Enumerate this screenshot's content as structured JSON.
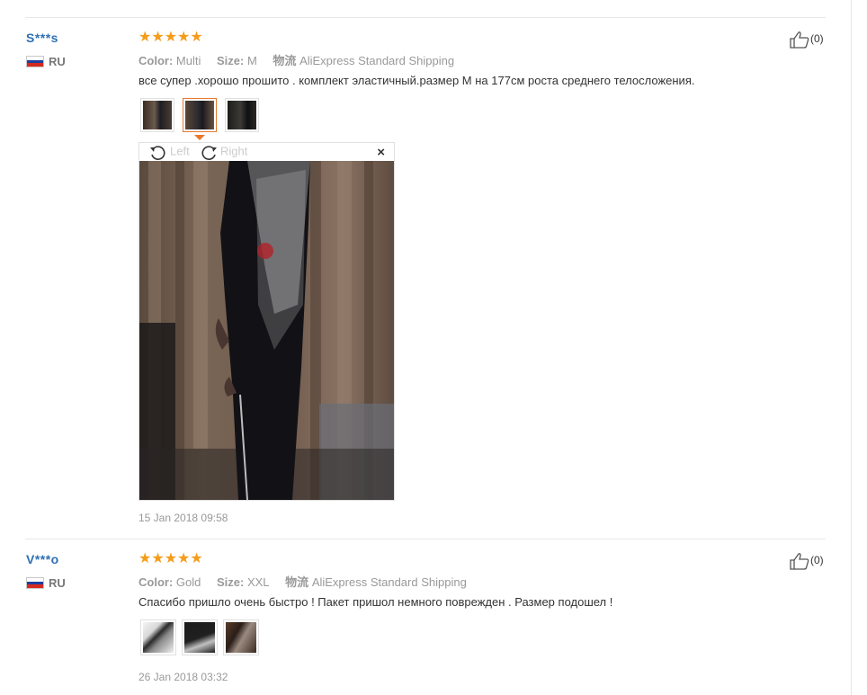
{
  "reviews": [
    {
      "user": "S***s",
      "country": "RU",
      "stars": "★★★★★",
      "color_label": "Color:",
      "color_value": "Multi",
      "size_label": "Size:",
      "size_value": "M",
      "shipping_label": "物流",
      "shipping_value": "AliExpress Standard Shipping",
      "text": "все супер .хорошо прошито . комплект эластичный.размер М на 177см роста среднего телосложения.",
      "likes": "(0)",
      "date": "15 Jan 2018 09:58",
      "viewer": {
        "rotate_left": "Left",
        "rotate_right": "Right",
        "close": "×"
      }
    },
    {
      "user": "V***o",
      "country": "RU",
      "stars": "★★★★★",
      "color_label": "Color:",
      "color_value": "Gold",
      "size_label": "Size:",
      "size_value": "XXL",
      "shipping_label": "物流",
      "shipping_value": "AliExpress Standard Shipping",
      "text": "Спасибо пришло очень быстро ! Пакет пришол немного поврежден . Размер подошел !",
      "likes": "(0)",
      "date": "26 Jan 2018 03:32"
    }
  ],
  "colors": {
    "star": "#f59c1a",
    "username": "#2f6fb3",
    "active_thumb": "#e8782e"
  },
  "icons": [
    "thumbs-up-icon",
    "rotate-left-icon",
    "rotate-right-icon",
    "close-icon",
    "flag-ru-icon",
    "star-icon"
  ]
}
